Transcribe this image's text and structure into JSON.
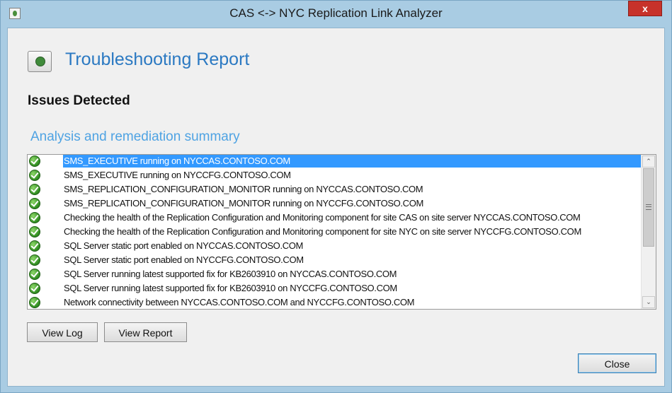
{
  "window": {
    "title": "CAS <-> NYC Replication Link Analyzer",
    "close_glyph": "x"
  },
  "header": {
    "icon": "report-icon",
    "title": "Troubleshooting Report"
  },
  "status_heading": "Issues Detected",
  "summary_heading": "Analysis and remediation summary",
  "results": [
    {
      "status": "check-icon",
      "text": "SMS_EXECUTIVE running on NYCCAS.CONTOSO.COM",
      "selected": true
    },
    {
      "status": "check-icon",
      "text": "SMS_EXECUTIVE running on NYCCFG.CONTOSO.COM"
    },
    {
      "status": "check-icon",
      "text": "SMS_REPLICATION_CONFIGURATION_MONITOR running on NYCCAS.CONTOSO.COM"
    },
    {
      "status": "check-icon",
      "text": "SMS_REPLICATION_CONFIGURATION_MONITOR running on NYCCFG.CONTOSO.COM"
    },
    {
      "status": "check-icon",
      "text": "Checking the health of the Replication Configuration and Monitoring component for site CAS on site server NYCCAS.CONTOSO.COM"
    },
    {
      "status": "check-icon",
      "text": "Checking the health of the Replication Configuration and Monitoring component for site NYC on site server NYCCFG.CONTOSO.COM"
    },
    {
      "status": "check-icon",
      "text": "SQL Server static port enabled on NYCCAS.CONTOSO.COM"
    },
    {
      "status": "check-icon",
      "text": "SQL Server static port enabled on NYCCFG.CONTOSO.COM"
    },
    {
      "status": "check-icon",
      "text": "SQL Server running latest supported fix for KB2603910 on NYCCAS.CONTOSO.COM"
    },
    {
      "status": "check-icon",
      "text": "SQL Server running latest supported fix for KB2603910 on NYCCFG.CONTOSO.COM"
    },
    {
      "status": "check-icon",
      "text": "Network connectivity between NYCCAS.CONTOSO.COM and NYCCFG.CONTOSO.COM"
    },
    {
      "status": "check-icon",
      "text": ""
    }
  ],
  "scrollbar": {
    "up_glyph": "⌃",
    "down_glyph": "⌄"
  },
  "buttons": {
    "view_log": "View Log",
    "view_report": "View Report",
    "close": "Close"
  },
  "colors": {
    "accent_title": "#2b79c2",
    "summary_heading": "#4fa3e3",
    "selection": "#3399ff",
    "close_button": "#c7322a"
  }
}
